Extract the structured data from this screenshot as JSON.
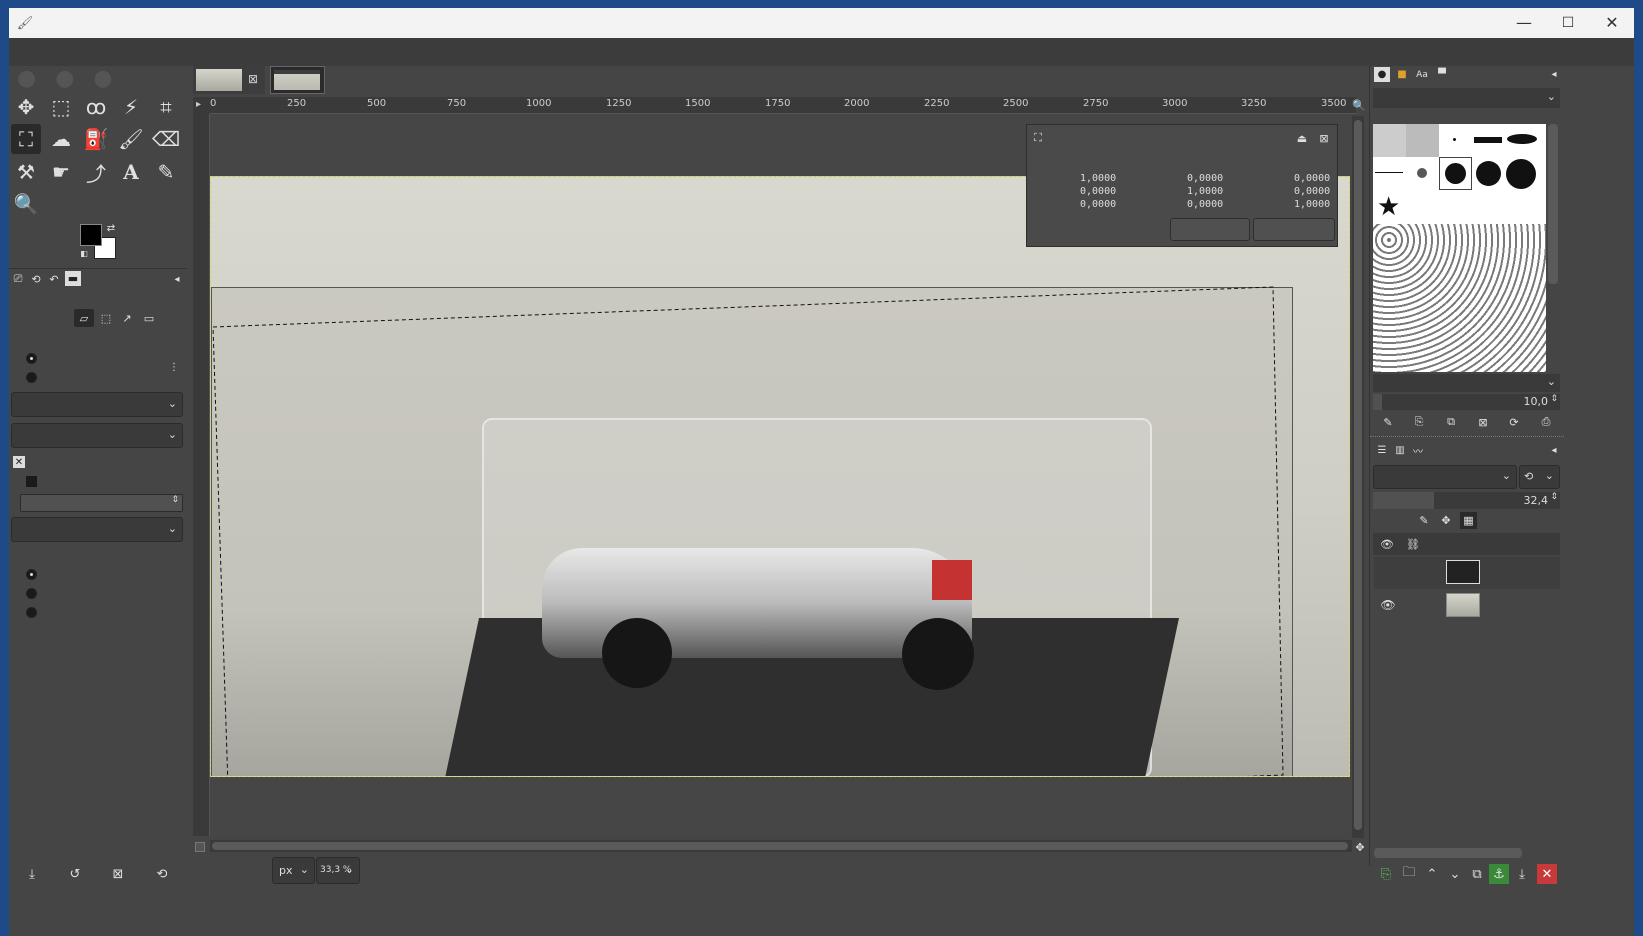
{
  "window": {
    "title": "",
    "controls": [
      "—",
      "☐",
      "✕"
    ]
  },
  "menu": [],
  "tabs": [
    {
      "label": "",
      "close": "⊠"
    },
    {
      "label": ""
    }
  ],
  "toolbox": {
    "tools": [
      "move-tool",
      "rect-select-tool",
      "free-select-tool",
      "fuzzy-select-tool",
      "crop-tool",
      "handle-transform-tool",
      "warp-tool",
      "bucket-fill-tool",
      "paintbrush-tool",
      "eraser-tool",
      "clone-tool",
      "smudge-tool",
      "path-tool",
      "text-tool",
      "color-picker-tool",
      "zoom-tool"
    ]
  },
  "tool_options": {
    "title": "",
    "transform_label": "",
    "direction_label": "",
    "dir_normal": "",
    "dir_corrective": "",
    "interpolation_label": "",
    "interpolation_value": "",
    "clipping_label": "",
    "clipping_value": "",
    "show_preview": "",
    "combined_preview": "",
    "image_opacity_label": "",
    "image_opacity_value": "",
    "guides_label": "",
    "guides_value": "",
    "handle_mode_label": "",
    "mode_add": "",
    "mode_move": "",
    "mode_remove": ""
  },
  "ruler": {
    "h_ticks": [
      "0",
      "250",
      "500",
      "750",
      "1000",
      "1250",
      "1500",
      "1750",
      "2000",
      "2250",
      "2500",
      "2750",
      "3000",
      "3250",
      "3500"
    ]
  },
  "transform_dialog": {
    "title": "",
    "subtitle": "",
    "matrix": [
      [
        "1,0000",
        "0,0000",
        "0,0000"
      ],
      [
        "0,0000",
        "1,0000",
        "0,0000"
      ],
      [
        "0,0000",
        "0,0000",
        "1,0000"
      ]
    ],
    "reset_label": "",
    "transform_label": ""
  },
  "status": {
    "unit": "px",
    "zoom": "33,3 %",
    "message": ""
  },
  "brushes": {
    "filter_placeholder": "",
    "current": "",
    "tag_value": "",
    "spacing_label": "",
    "spacing_value": "10,0"
  },
  "layers": {
    "mode_label": "",
    "mode_value": "",
    "opacity_label": "",
    "opacity_value": "32,4",
    "opacity_fraction": 0.324,
    "lock_label": "",
    "items": [
      {
        "name": "",
        "sub": "",
        "visible": false
      },
      {
        "name": "",
        "sub": "",
        "visible": true
      }
    ]
  },
  "colors": {
    "accent_selection": "#d8d860",
    "fg": "#000000",
    "bg": "#ffffff",
    "delete_red": "#c83a3a",
    "anchor_green": "#3a8a3a"
  }
}
